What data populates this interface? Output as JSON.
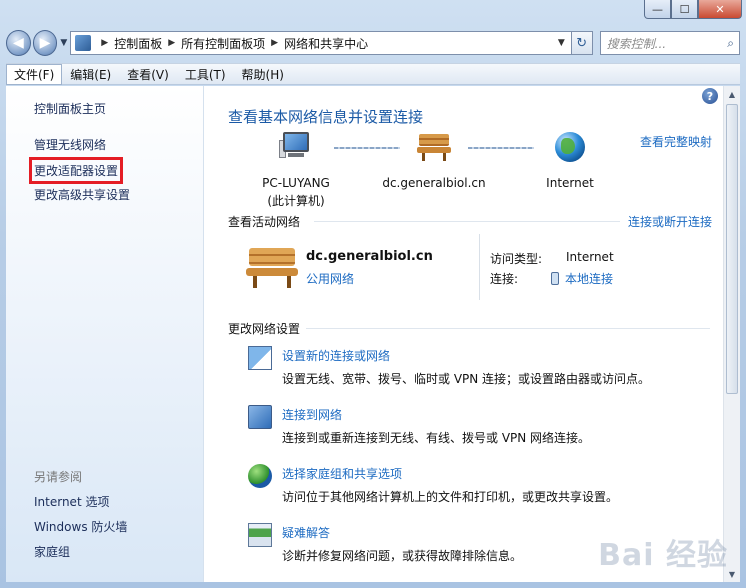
{
  "window": {
    "ghost_title": "",
    "caption": {
      "minimize": "—",
      "maximize": "☐",
      "close": "✕"
    }
  },
  "nav": {
    "back": "◀",
    "forward": "▶",
    "breadcrumbs": [
      "控制面板",
      "所有控制面板项",
      "网络和共享中心"
    ],
    "search_placeholder": "搜索控制..."
  },
  "menu": [
    "文件(F)",
    "编辑(E)",
    "查看(V)",
    "工具(T)",
    "帮助(H)"
  ],
  "sidebar": {
    "home": "控制面板主页",
    "links": [
      "管理无线网络",
      "更改适配器设置",
      "更改高级共享设置"
    ],
    "see_also_heading": "另请参阅",
    "see_also": [
      "Internet 选项",
      "Windows 防火墙",
      "家庭组"
    ]
  },
  "main": {
    "title": "查看基本网络信息并设置连接",
    "full_map_link": "查看完整映射",
    "map": {
      "computer": {
        "name": "PC-LUYANG",
        "note": "(此计算机)"
      },
      "network": "dc.generalbiol.cn",
      "internet": "Internet"
    },
    "active": {
      "heading": "查看活动网络",
      "link": "连接或断开连接",
      "name": "dc.generalbiol.cn",
      "type": "公用网络",
      "access_label": "访问类型:",
      "access_value": "Internet",
      "connection_label": "连接:",
      "connection_value": "本地连接"
    },
    "change": {
      "heading": "更改网络设置",
      "tasks": [
        {
          "title": "设置新的连接或网络",
          "desc": "设置无线、宽带、拨号、临时或 VPN 连接；或设置路由器或访问点。"
        },
        {
          "title": "连接到网络",
          "desc": "连接到或重新连接到无线、有线、拨号或 VPN 网络连接。"
        },
        {
          "title": "选择家庭组和共享选项",
          "desc": "访问位于其他网络计算机上的文件和打印机，或更改共享设置。"
        },
        {
          "title": "疑难解答",
          "desc": "诊断并修复网络问题，或获得故障排除信息。"
        }
      ]
    }
  },
  "watermark": "Bai 经验",
  "colors": {
    "link": "#1d6bc2",
    "title": "#1b5aa6",
    "highlight": "#e41d25"
  }
}
